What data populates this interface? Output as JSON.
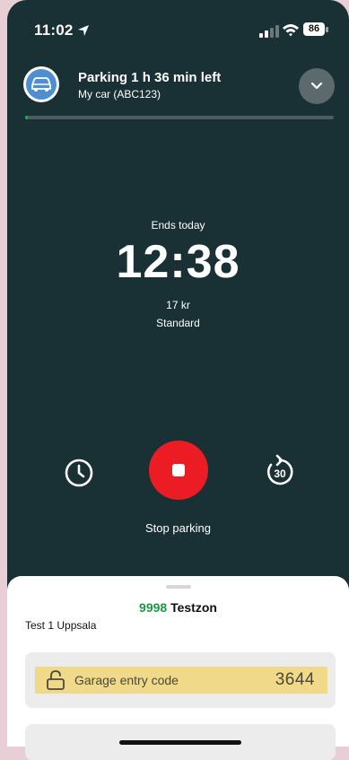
{
  "status_bar": {
    "time": "11:02",
    "battery": "86",
    "icons": [
      "location-arrow-icon",
      "signal-icon",
      "wifi-icon",
      "battery-icon"
    ]
  },
  "header": {
    "title": "Parking 1 h 36 min left",
    "subtitle": "My car (ABC123)",
    "avatar_icon": "car-icon",
    "expand_icon": "chevron-down-icon"
  },
  "progress": {
    "fraction": 0.01,
    "color": "#1faa4e"
  },
  "session": {
    "ends_label": "Ends today",
    "end_time": "12:38",
    "price": "17 kr",
    "tariff": "Standard"
  },
  "controls": {
    "left_icon": "clock-icon",
    "center_icon": "stop-icon",
    "right_icon": "rotate-30-icon",
    "right_icon_text": "30",
    "stop_label": "Stop parking",
    "stop_color": "#ec1c24"
  },
  "zone": {
    "code": "9998",
    "name": "Testzon",
    "city": "Test 1 Uppsala"
  },
  "garage": {
    "label": "Garage entry code",
    "code": "3644",
    "icon": "unlock-icon",
    "highlight_color": "#f1d98a"
  },
  "colors": {
    "background": "#193035",
    "accent_green": "#1a9a45"
  }
}
